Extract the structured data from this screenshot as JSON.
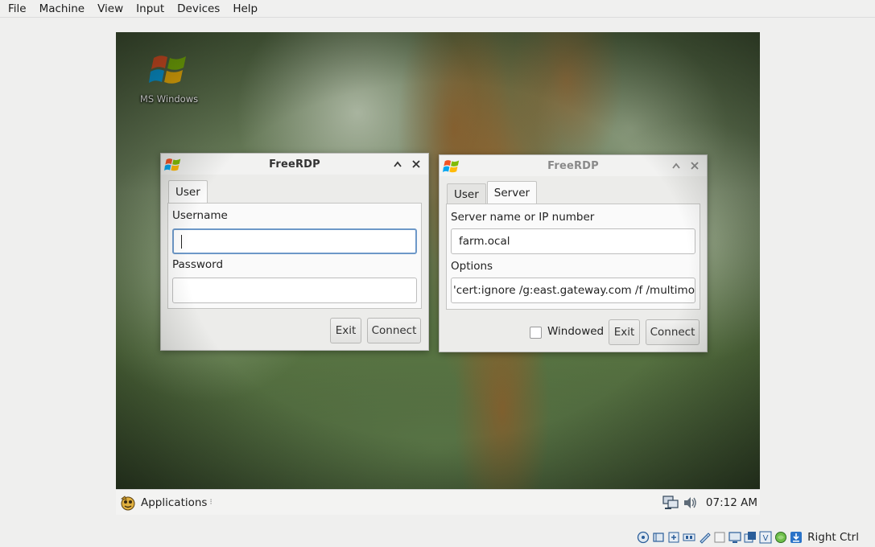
{
  "menubar": {
    "items": [
      "File",
      "Machine",
      "View",
      "Input",
      "Devices",
      "Help"
    ]
  },
  "desktop": {
    "icon_label": "MS Windows"
  },
  "window_user": {
    "title": "FreeRDP",
    "tabs": [
      "User"
    ],
    "username_label": "Username",
    "username_value": "",
    "password_label": "Password",
    "password_value": "",
    "exit_label": "Exit",
    "connect_label": "Connect"
  },
  "window_server": {
    "title": "FreeRDP",
    "tabs": [
      "User",
      "Server"
    ],
    "active_tab": "Server",
    "server_label": "Server name or IP number",
    "server_value": "farm.ocal",
    "options_label": "Options",
    "options_value": "'cert:ignore /g:east.gateway.com /f /multimon:",
    "windowed_label": "Windowed",
    "windowed_checked": false,
    "exit_label": "Exit",
    "connect_label": "Connect"
  },
  "taskbar": {
    "applications_label": "Applications",
    "clock": "07:12 AM"
  },
  "statusbar": {
    "host_key": "Right Ctrl",
    "icons": [
      "hard-disk-icon",
      "optical-drive-icon",
      "audio-icon",
      "network-icon",
      "usb-icon",
      "shared-folder-icon",
      "display-icon",
      "recording-icon",
      "virtualization-icon",
      "mouse-integration-icon",
      "host-key-download-icon"
    ]
  },
  "colors": {
    "focus_border": "#6d98c8",
    "window_bg": "#ececea"
  }
}
